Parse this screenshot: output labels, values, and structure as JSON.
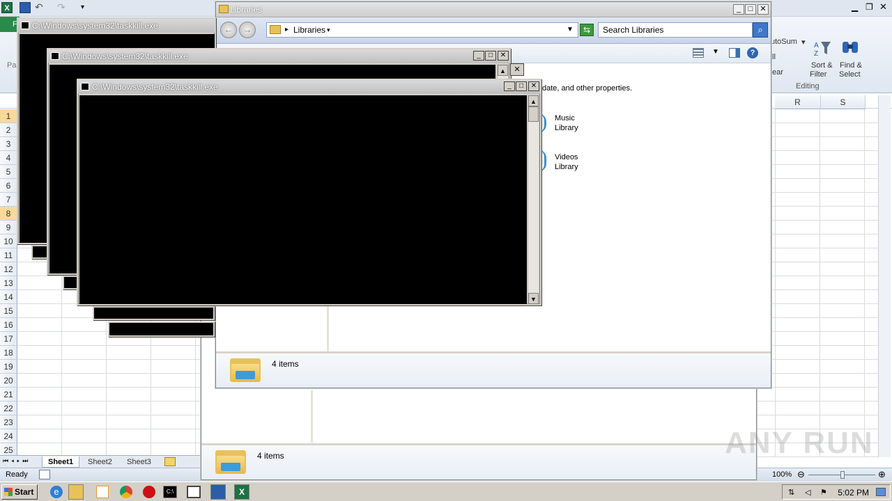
{
  "excel": {
    "ribbon": {
      "autosum": "utoSum",
      "fill": "ll",
      "clear": "ear",
      "sort_filter_line1": "Sort &",
      "sort_filter_line2": "Filter",
      "find_select_line1": "Find &",
      "find_select_line2": "Select",
      "editing_group": "Editing",
      "paste_fragment": "Pa",
      "file_fragment": "F"
    },
    "columns": [
      "R",
      "S"
    ],
    "rows": [
      "1",
      "2",
      "3",
      "4",
      "5",
      "6",
      "7",
      "8",
      "9",
      "10",
      "11",
      "12",
      "13",
      "14",
      "15",
      "16",
      "17",
      "18",
      "19",
      "20",
      "21",
      "22",
      "23",
      "24",
      "25"
    ],
    "sheets": [
      "Sheet1",
      "Sheet2",
      "Sheet3"
    ],
    "status": "Ready",
    "zoom": "100%"
  },
  "explorer_back": {
    "items_count": "4 items"
  },
  "explorer": {
    "title": "Libraries",
    "address": "Libraries",
    "search_placeholder": "Search Libraries",
    "description": "date, and other properties.",
    "libraries": [
      {
        "name": "Music",
        "type": "Library"
      },
      {
        "name": "Videos",
        "type": "Library"
      }
    ],
    "items_count": "4 items"
  },
  "consoles": [
    {
      "title": "C:\\Windows\\system32\\taskkill.exe"
    },
    {
      "title": "C:\\Windows\\system32\\taskkill.exe"
    },
    {
      "title": "C:\\Windows\\system32\\taskkill.exe"
    }
  ],
  "taskbar": {
    "start": "Start",
    "clock": "5:02 PM"
  },
  "watermark": "ANY RUN"
}
